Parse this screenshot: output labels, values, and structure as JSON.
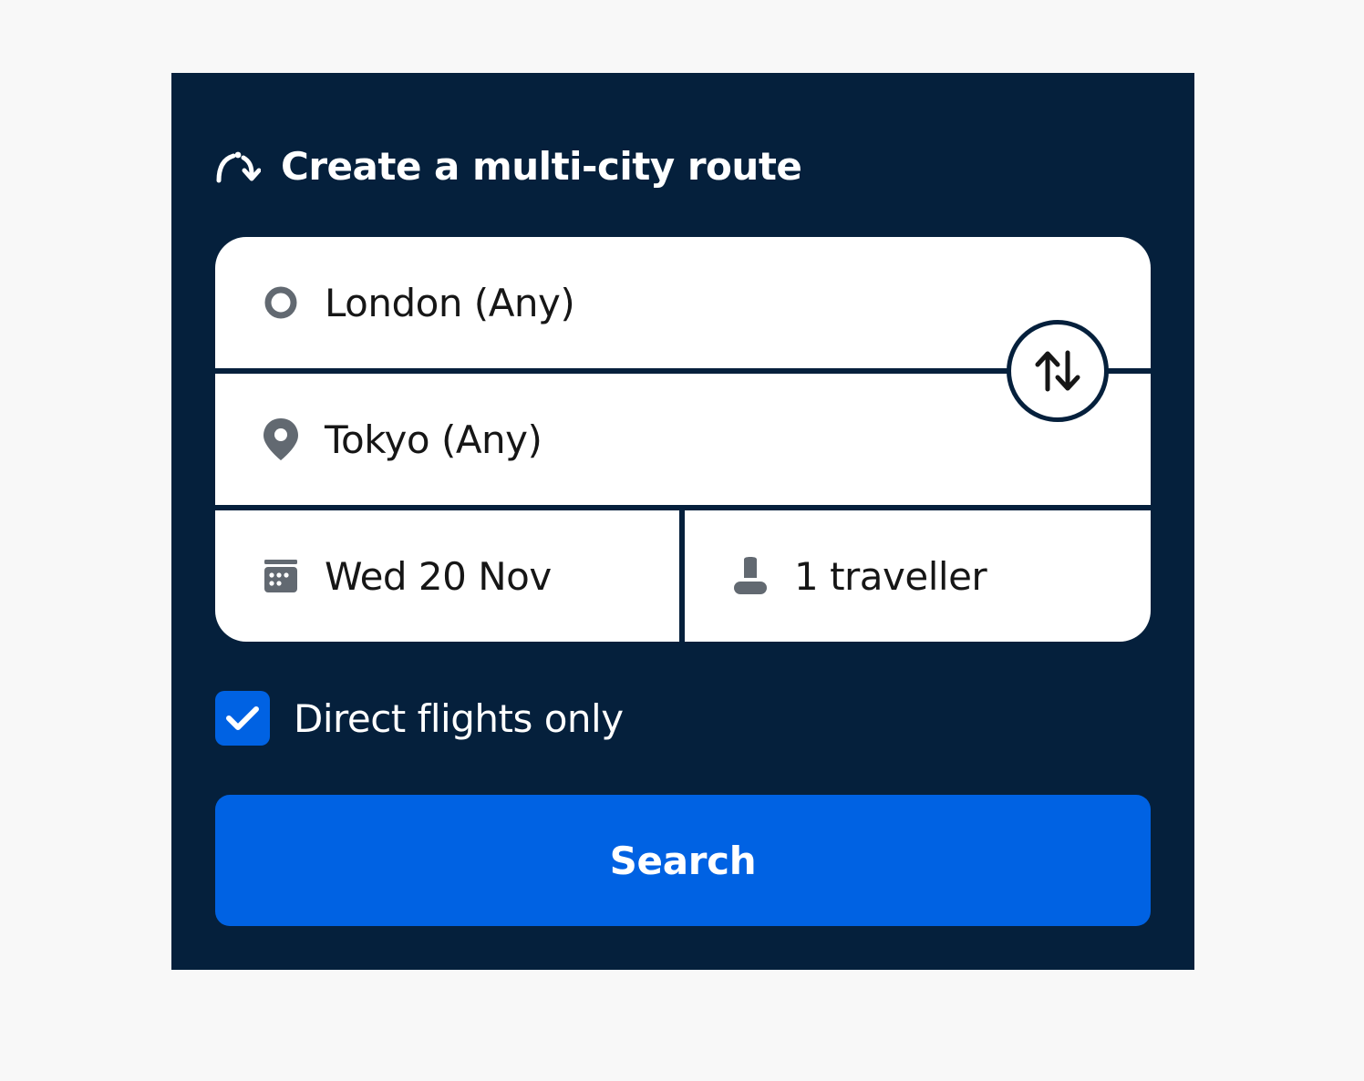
{
  "header": {
    "title": "Create a multi-city route",
    "icon": "multi-city-route-icon"
  },
  "fields": {
    "origin": {
      "value": "London (Any)",
      "icon": "origin-circle-icon"
    },
    "destination": {
      "value": "Tokyo (Any)",
      "icon": "location-pin-icon"
    },
    "date": {
      "value": "Wed 20 Nov",
      "icon": "calendar-icon"
    },
    "travellers": {
      "value": "1 traveller",
      "icon": "person-icon"
    }
  },
  "swap": {
    "icon": "swap-arrows-icon"
  },
  "direct_flights": {
    "label": "Direct flights only",
    "checked": true,
    "icon": "checkmark-icon"
  },
  "search": {
    "label": "Search"
  },
  "colors": {
    "page_background": "#f8f8f8",
    "panel_background": "#05203c",
    "accent_blue": "#0062e3",
    "field_background": "#ffffff",
    "icon_gray": "#626971",
    "text_dark": "#161616"
  }
}
